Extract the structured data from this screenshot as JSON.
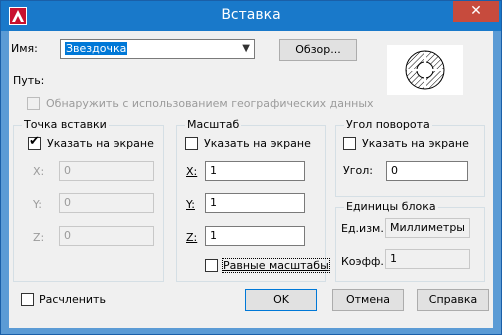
{
  "title": "Вставка",
  "close_glyph": "✕",
  "name": {
    "label": "Имя:",
    "value": "Звездочка",
    "browse_button": "Обзор..."
  },
  "path_label": "Путь:",
  "geo_checkbox": "Обнаружить с использованием географических данных",
  "insert_point": {
    "title": "Точка вставки",
    "on_screen": "Указать на экране",
    "fields": [
      {
        "label": "X:",
        "value": "0"
      },
      {
        "label": "Y:",
        "value": "0"
      },
      {
        "label": "Z:",
        "value": "0"
      }
    ]
  },
  "scale": {
    "title": "Масштаб",
    "on_screen": "Указать на экране",
    "fields": [
      {
        "label": "X:",
        "value": "1"
      },
      {
        "label": "Y:",
        "value": "1"
      },
      {
        "label": "Z:",
        "value": "1"
      }
    ],
    "uniform": "Равные масштабы"
  },
  "rotation": {
    "title": "Угол поворота",
    "on_screen": "Указать на экране",
    "angle_label": "Угол:",
    "angle_value": "0"
  },
  "block_units": {
    "title": "Единицы блока",
    "unit_label": "Ед.изм.:",
    "unit_value": "Миллиметры",
    "factor_label": "Коэфф.:",
    "factor_value": "1"
  },
  "explode": "Расчленить",
  "buttons": {
    "ok": "OK",
    "cancel": "Отмена",
    "help": "Справка"
  },
  "colors": {
    "titlebar": "#1979ca",
    "close": "#c74b3d",
    "dialog_bg": "#f0f0f0"
  }
}
